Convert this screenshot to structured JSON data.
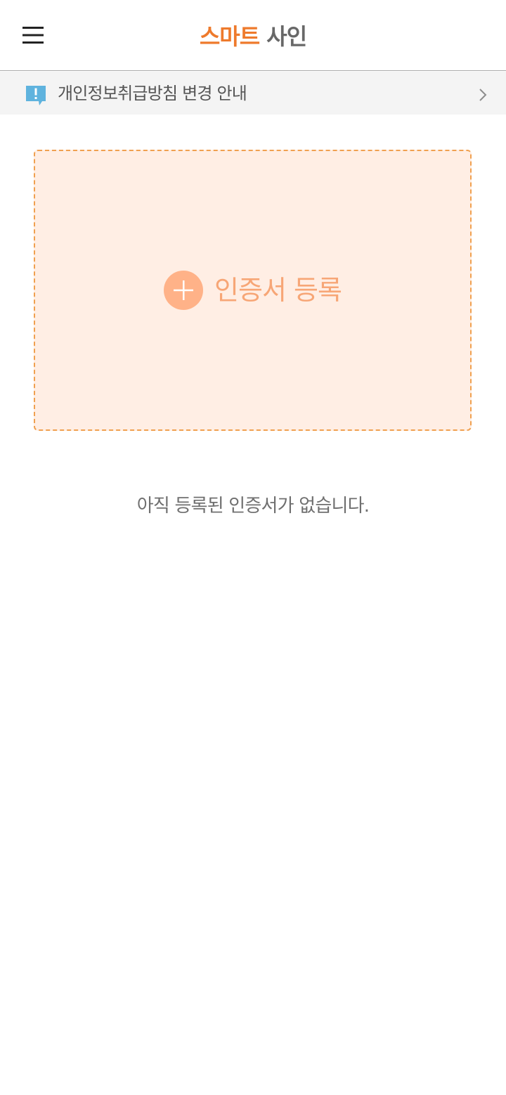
{
  "header": {
    "menu_icon": "hamburger-menu-icon",
    "title_accent": "스마트",
    "title_plain": "사인",
    "accent_color": "#ee7a2c"
  },
  "notice": {
    "icon": "notice-alert-icon",
    "text": "개인정보취급방침 변경 안내",
    "chevron_icon": "chevron-right-icon",
    "icon_color": "#5fb3de"
  },
  "register": {
    "icon": "plus-circle-icon",
    "label": "인증서 등록",
    "background_color": "#ffeee4",
    "border_color": "#f0a04f"
  },
  "empty_state": {
    "message": "아직 등록된 인증서가 없습니다."
  }
}
